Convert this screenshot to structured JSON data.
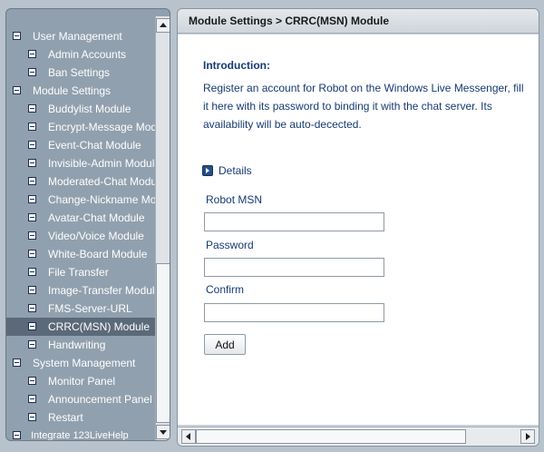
{
  "sidebar": {
    "items": [
      {
        "label": "User Management",
        "level": 0
      },
      {
        "label": "Admin Accounts",
        "level": 1
      },
      {
        "label": "Ban Settings",
        "level": 1
      },
      {
        "label": "Module Settings",
        "level": 0
      },
      {
        "label": "Buddylist Module",
        "level": 1
      },
      {
        "label": "Encrypt-Message Module",
        "level": 1
      },
      {
        "label": "Event-Chat Module",
        "level": 1
      },
      {
        "label": "Invisible-Admin Module",
        "level": 1
      },
      {
        "label": "Moderated-Chat Module",
        "level": 1
      },
      {
        "label": "Change-Nickname Module",
        "level": 1
      },
      {
        "label": "Avatar-Chat Module",
        "level": 1
      },
      {
        "label": "Video/Voice Module",
        "level": 1
      },
      {
        "label": "White-Board Module",
        "level": 1
      },
      {
        "label": "File Transfer",
        "level": 1
      },
      {
        "label": "Image-Transfer Module",
        "level": 1
      },
      {
        "label": "FMS-Server-URL",
        "level": 1
      },
      {
        "label": "CRRC(MSN) Module",
        "level": 1,
        "selected": true
      },
      {
        "label": "Handwriting",
        "level": 1
      },
      {
        "label": "System Management",
        "level": 0
      },
      {
        "label": "Monitor Panel",
        "level": 1
      },
      {
        "label": "Announcement Panel",
        "level": 1
      },
      {
        "label": "Restart",
        "level": 1
      },
      {
        "label": "Integrate 123LiveHelp",
        "level": 0
      }
    ]
  },
  "main": {
    "title": "Module Settings > CRRC(MSN) Module",
    "intro_heading": "Introduction:",
    "intro_text": "Register an account for Robot on the Windows Live Messenger, fill it here with its password to binding it with the chat server. Its availability will be auto-decected.",
    "details_label": "Details",
    "fields": {
      "robot_msn_label": "Robot MSN",
      "robot_msn_value": "",
      "password_label": "Password",
      "password_value": "",
      "confirm_label": "Confirm",
      "confirm_value": ""
    },
    "add_button": "Add"
  },
  "colors": {
    "sidebar_bg": "#91a0ae",
    "selected_bg": "#5b6979",
    "text_blue": "#153a73"
  }
}
